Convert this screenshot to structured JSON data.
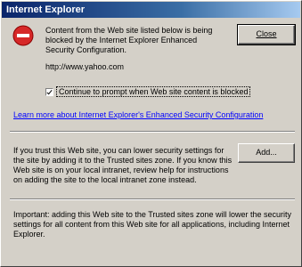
{
  "window": {
    "title": "Internet Explorer"
  },
  "message": "Content from the Web site listed below is being blocked by the Internet Explorer Enhanced Security Configuration.",
  "site_url": "http://www.yahoo.com",
  "continue_checkbox": {
    "label": "Continue to prompt when Web site content is blocked",
    "checked": true
  },
  "learn_more_link": "Learn more about Internet Explorer's Enhanced Security Configuration",
  "trust_text": "If you trust this Web site, you can lower security settings for the site by adding it to the Trusted sites zone. If you know this Web site is on your local intranet, review help for instructions on adding the site to the local intranet zone instead.",
  "important_text": "Important: adding this Web site to the Trusted sites zone will lower the security settings for all content from this Web site for all applications, including Internet Explorer.",
  "buttons": {
    "close": "Close",
    "add": "Add..."
  },
  "icons": {
    "block": "stop-icon"
  },
  "colors": {
    "title_start": "#0a246a",
    "title_end": "#a6caf0",
    "icon_red": "#d62828",
    "link": "#0000ff"
  }
}
